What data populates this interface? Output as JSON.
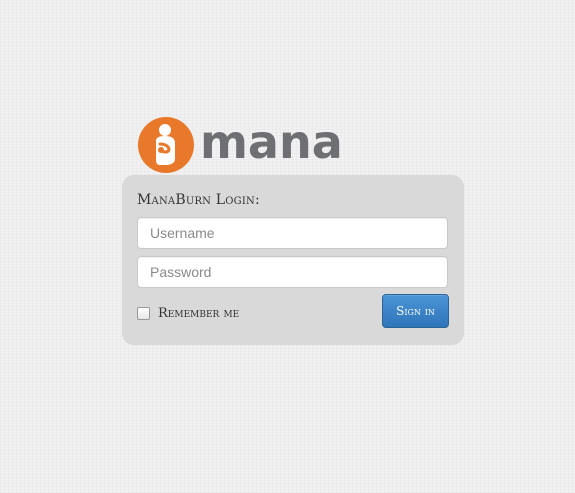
{
  "logo": {
    "text": "mana",
    "icon": "mana-person-icon",
    "brand_color": "#e8782a",
    "text_color": "#6e6f72"
  },
  "login": {
    "title": "ManaBurn Login:",
    "username_placeholder": "Username",
    "password_placeholder": "Password",
    "remember_label": "Remember me",
    "remember_checked": false,
    "signin_label": "Sign in",
    "button_color": "#337ab7"
  }
}
